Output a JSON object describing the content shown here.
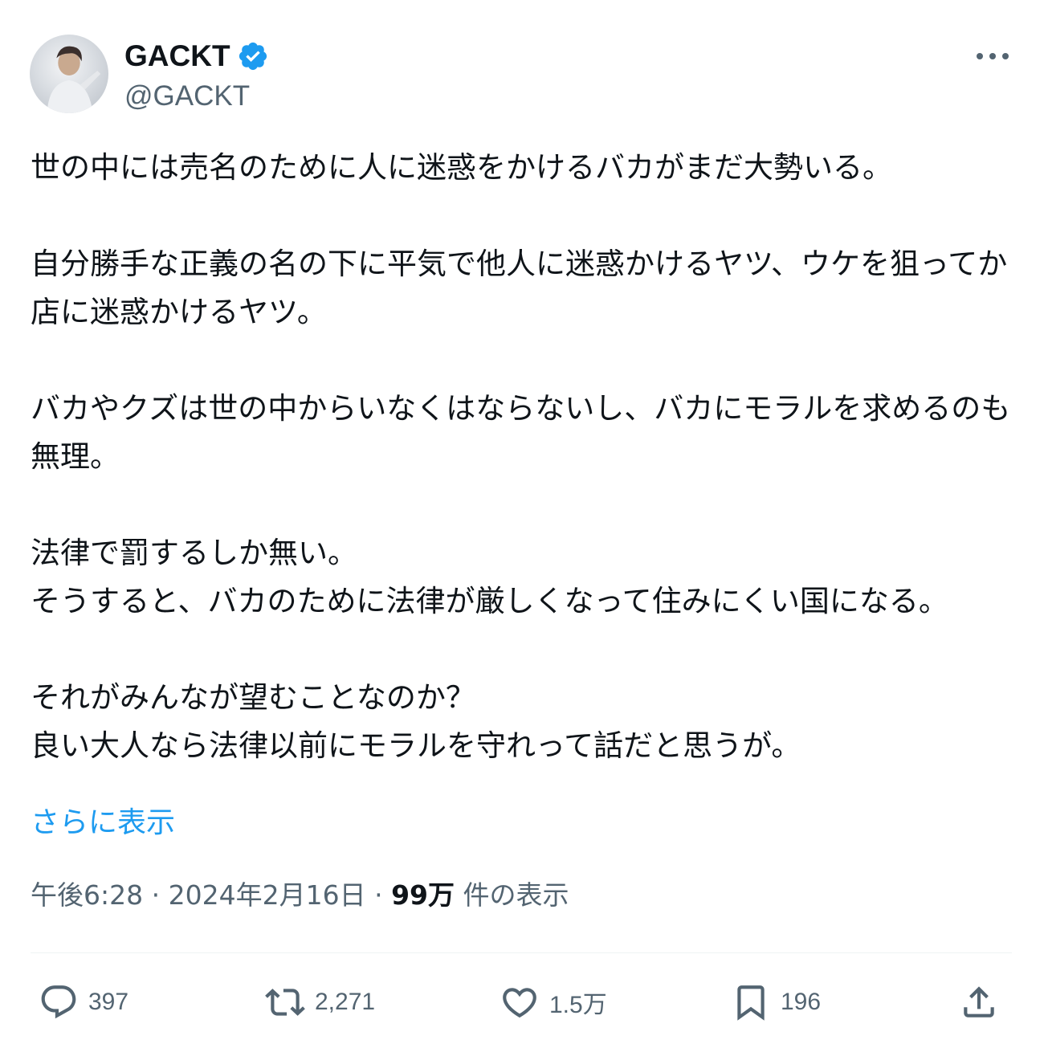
{
  "author": {
    "display_name": "GACKT",
    "handle": "@GACKT",
    "verified": true,
    "avatar_icon": "profile-photo"
  },
  "menu_icon": "more-options-icon",
  "tweet": {
    "text": "世の中には売名のために人に迷惑をかけるバカがまだ大勢いる。\n\n自分勝手な正義の名の下に平気で他人に迷惑かけるヤツ、ウケを狙ってか店に迷惑かけるヤツ。\n\nバカやクズは世の中からいなくはならないし、バカにモラルを求めるのも無理。\n\n法律で罰するしか無い。\nそうすると、バカのために法律が厳しくなって住みにくい国になる。\n\nそれがみんなが望むことなのか？\n良い大人なら法律以前にモラルを守れって話だと思うが。",
    "show_more": "さらに表示"
  },
  "meta": {
    "time": "午後6:28",
    "separator1": " · ",
    "date": "2024年2月16日",
    "separator2": " · ",
    "views_count": "99万",
    "views_label": " 件の表示"
  },
  "actions": {
    "replies": "397",
    "retweets": "2,271",
    "likes": "1.5万",
    "bookmarks": "196"
  },
  "colors": {
    "text": "#0f1419",
    "secondary": "#536471",
    "link": "#1d9bf0",
    "verified": "#1d9bf0",
    "divider": "#eff3f4"
  }
}
